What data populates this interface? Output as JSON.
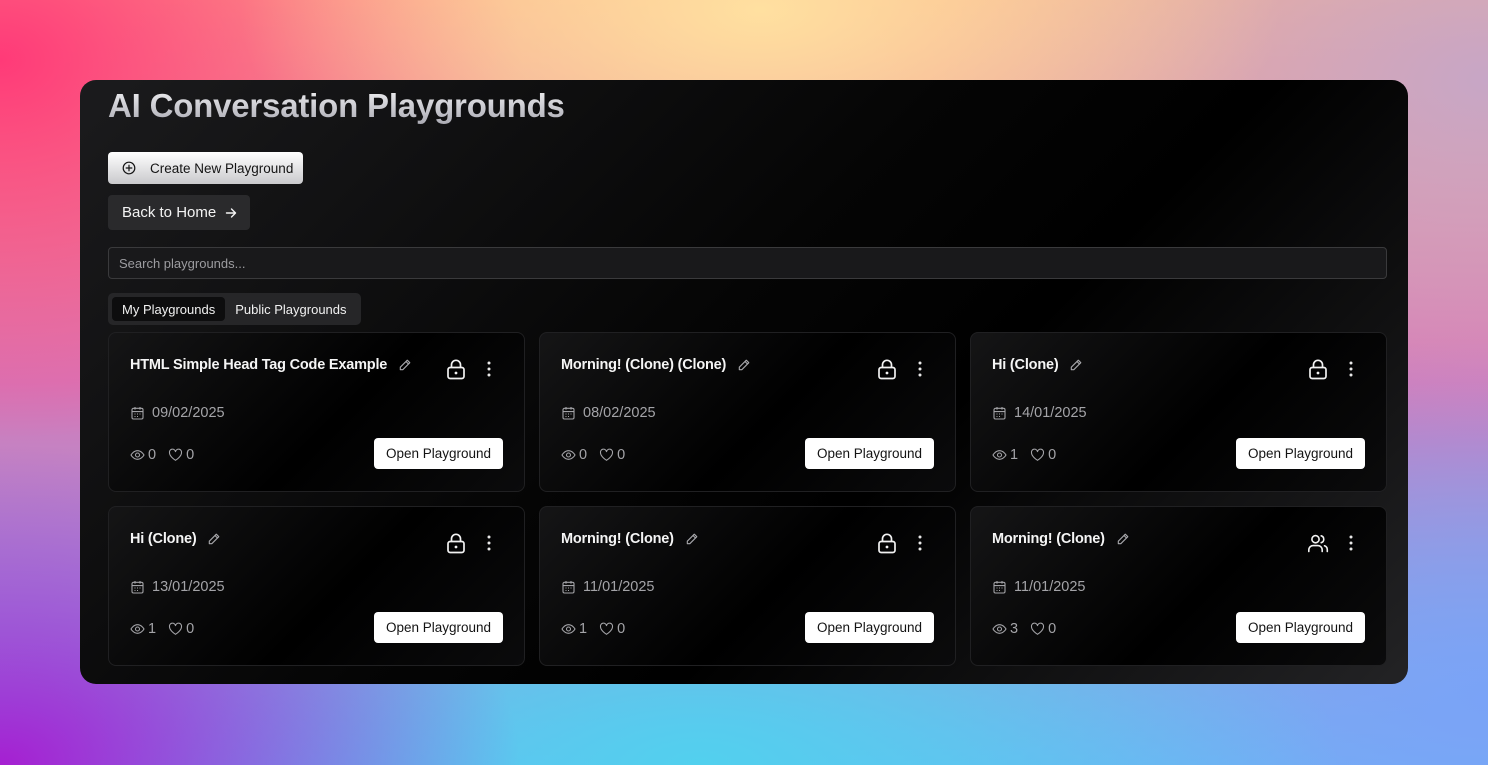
{
  "app": {
    "title": "AI Conversation Playgrounds"
  },
  "actions": {
    "create_label": "Create New Playground",
    "create_icon": "plus-circle-icon",
    "back_label": "Back to Home",
    "back_icon": "arrow-right-icon"
  },
  "search": {
    "placeholder": "Search playgrounds...",
    "value": ""
  },
  "tabs": [
    {
      "label": "My Playgrounds",
      "active": true
    },
    {
      "label": "Public Playgrounds",
      "active": false
    }
  ],
  "cards": [
    {
      "title": "HTML Simple Head Tag Code Example",
      "privacy_icon": "lock-icon",
      "date": "09/02/2025",
      "views": "0",
      "likes": "0",
      "action_label": "Open Playground"
    },
    {
      "title": "Morning! (Clone) (Clone)",
      "privacy_icon": "lock-icon",
      "date": "08/02/2025",
      "views": "0",
      "likes": "0",
      "action_label": "Open Playground"
    },
    {
      "title": "Hi (Clone)",
      "privacy_icon": "lock-icon",
      "date": "14/01/2025",
      "views": "1",
      "likes": "0",
      "action_label": "Open Playground"
    },
    {
      "title": "Hi (Clone)",
      "privacy_icon": "lock-icon",
      "date": "13/01/2025",
      "views": "1",
      "likes": "0",
      "action_label": "Open Playground"
    },
    {
      "title": "Morning! (Clone)",
      "privacy_icon": "lock-icon",
      "date": "11/01/2025",
      "views": "1",
      "likes": "0",
      "action_label": "Open Playground"
    },
    {
      "title": "Morning! (Clone)",
      "privacy_icon": "users-icon",
      "date": "11/01/2025",
      "views": "3",
      "likes": "0",
      "action_label": "Open Playground"
    }
  ],
  "colors": {
    "panel_background": "#000000",
    "card_border": "#202022",
    "button_white": "#ffffff",
    "muted_text": "#a4a4a8"
  }
}
